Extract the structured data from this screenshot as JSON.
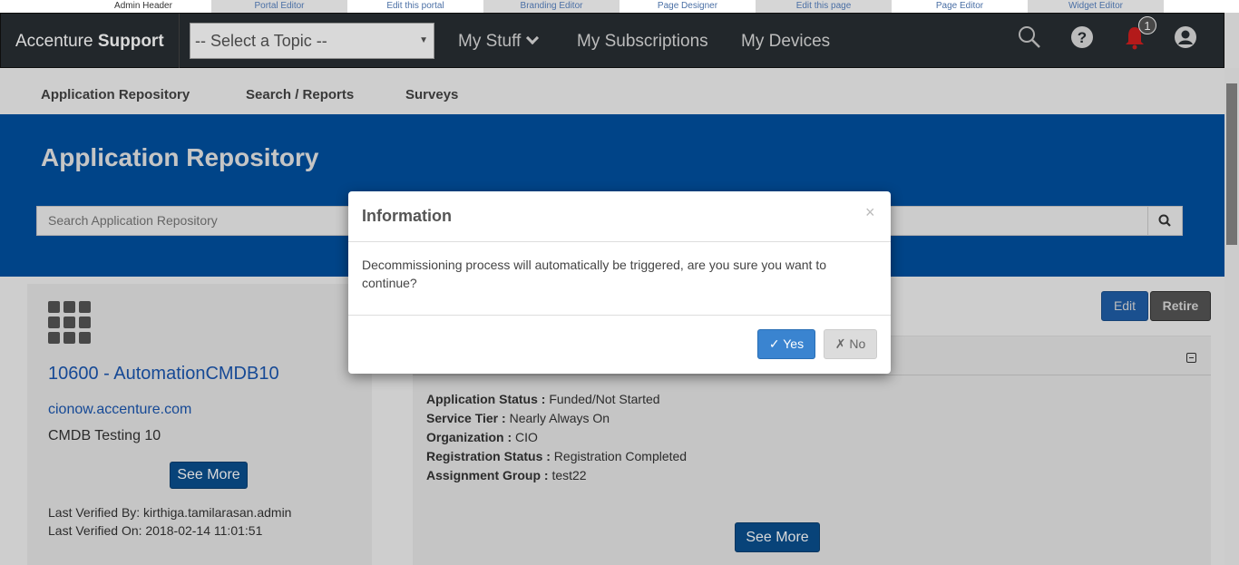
{
  "admin_strip": {
    "items": [
      "Admin Header",
      "Portal Editor",
      "Edit this portal",
      "Branding Editor",
      "Page Designer",
      "Edit this page",
      "Page Editor",
      "Widget Editor"
    ]
  },
  "header": {
    "brand_prefix": "Accenture",
    "brand_bold": "Support",
    "topic_select": "-- Select a Topic --",
    "nav": [
      "My Stuff",
      "My Subscriptions",
      "My Devices"
    ],
    "notification_count": "1",
    "icons": [
      "search-icon",
      "help-icon",
      "bell-icon",
      "user-icon"
    ]
  },
  "subnav": {
    "items": [
      "Application Repository",
      "Search / Reports",
      "Surveys"
    ]
  },
  "banner": {
    "title": "Application Repository",
    "search_placeholder": "Search Application Repository"
  },
  "app_card": {
    "title": "10600 - AutomationCMDB10",
    "link": "cionow.accenture.com",
    "description": "CMDB Testing 10",
    "see_more": "See More",
    "verified_by": "Last Verified By: kirthiga.tamilarasan.admin",
    "verified_on": "Last Verified On: 2018-02-14 11:01:51"
  },
  "actions": {
    "edit": "Edit",
    "retire": "Retire"
  },
  "details": {
    "rows": [
      {
        "label": "Application Status :",
        "value": " Funded/Not Started"
      },
      {
        "label": "Service Tier :",
        "value": " Nearly Always On"
      },
      {
        "label": "Organization :",
        "value": " CIO"
      },
      {
        "label": "Registration Status :",
        "value": " Registration Completed"
      },
      {
        "label": "Assignment Group :",
        "value": " test22"
      }
    ],
    "see_more": "See More"
  },
  "modal": {
    "title": "Information",
    "close": "×",
    "body": "Decommissioning process will automatically be triggered, are you sure you want to continue?",
    "yes": "✓ Yes",
    "no": "✗ No"
  },
  "colors": {
    "header_bg": "#282e33",
    "banner_bg": "#0050a0",
    "primary_button": "#0a4f8f",
    "notification": "#d31f1f"
  }
}
